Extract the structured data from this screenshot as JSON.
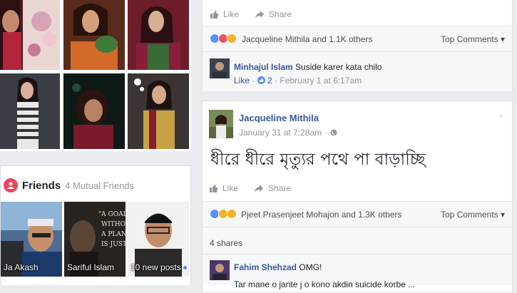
{
  "photos": {
    "items": [
      "photo-1",
      "photo-2",
      "photo-3",
      "photo-4",
      "photo-5",
      "photo-6"
    ]
  },
  "friends": {
    "title": "Friends",
    "count": "4 Mutual Friends",
    "items": [
      {
        "name": "Ja Akash"
      },
      {
        "name": "Sariful Islam"
      },
      {
        "name": "10 new posts"
      }
    ]
  },
  "post1": {
    "like_label": "Like",
    "share_label": "Share",
    "reactions_text": "Jacqueline Mithila and 1.1K others",
    "top_comments_label": "Top Comments ▾",
    "comment": {
      "author": "Minhajul Islam",
      "text": "Suside karer kata chilo",
      "like_label": "Like",
      "likes": "2",
      "timestamp": "February 1 at 6:17am"
    }
  },
  "post2": {
    "author": "Jacqueline Mithila",
    "timestamp": "January 31 at 7:28am",
    "text": "ধীরে ধীরে মৃত্যুর পথে পা বাড়াচ্ছি",
    "like_label": "Like",
    "share_label": "Share",
    "reactions_text": "Pjeet Prasenjeet Mohajon and 1.3K others",
    "top_comments_label": "Top Comments ▾",
    "shares": "4 shares",
    "comment": {
      "author": "Fahim Shehzad",
      "text": "OMG!",
      "text2": "Tar mane o jante j o kono akdin suicide korbe ..."
    }
  },
  "colors": {
    "link": "#365899",
    "meta": "#90949c",
    "like_blue": "#5890ff",
    "love_red": "#f25268",
    "haha_yellow": "#f7b125",
    "friends_icon": "#e8465d"
  }
}
